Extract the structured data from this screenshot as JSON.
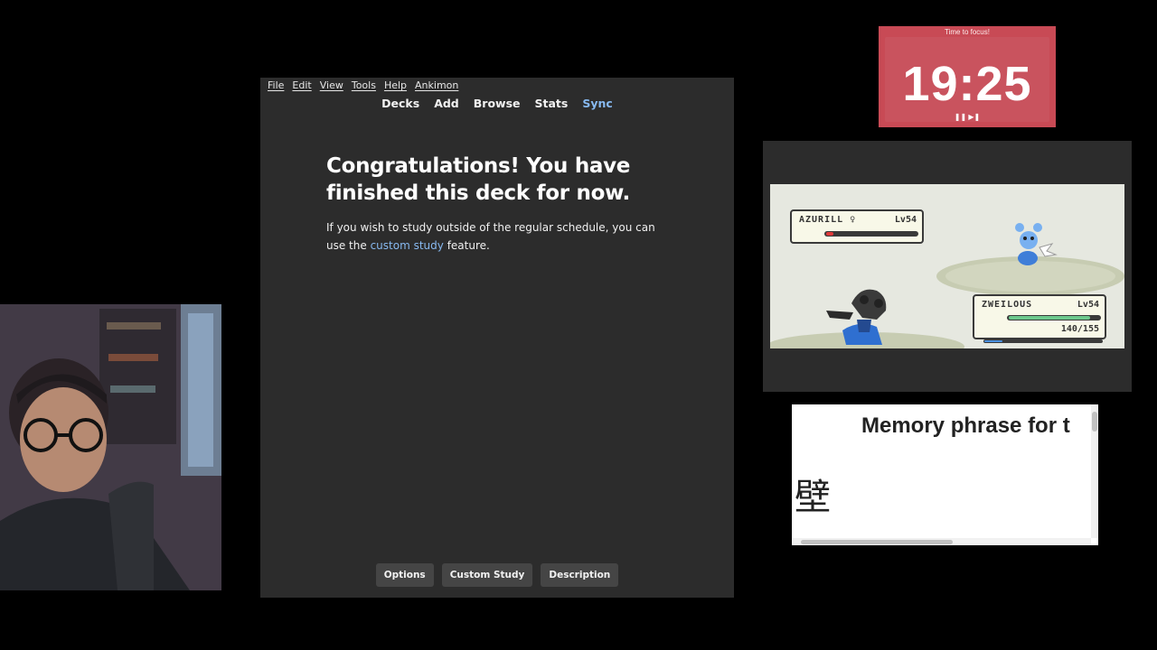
{
  "anki": {
    "menu": [
      "File",
      "Edit",
      "View",
      "Tools",
      "Help",
      "Ankimon"
    ],
    "tabs": [
      "Decks",
      "Add",
      "Browse",
      "Stats",
      "Sync"
    ],
    "heading": "Congratulations! You have finished this deck for now.",
    "body_prefix": "If you wish to study outside of the regular schedule, you can use the",
    "body_link": "custom study",
    "body_suffix": "feature.",
    "buttons": [
      "Options",
      "Custom Study",
      "Description"
    ]
  },
  "timer": {
    "title": "Time to focus!",
    "time": "19:25",
    "controls": "❚❚ ▶❚"
  },
  "battle": {
    "enemy": {
      "name": "AZURILL ♀",
      "level": "Lv54",
      "hp_fraction": 0.08
    },
    "player": {
      "name": "ZWEILOUS",
      "level": "Lv54",
      "hp_text": "140/155",
      "hp_fraction": 0.9,
      "exp_fraction": 0.15
    },
    "colors": {
      "hp_red": "#e03a3a",
      "hp_green": "#6cc88c",
      "exp_blue": "#4a90e0"
    }
  },
  "memory": {
    "phrase": "Memory phrase for t",
    "kanji": "壁"
  }
}
